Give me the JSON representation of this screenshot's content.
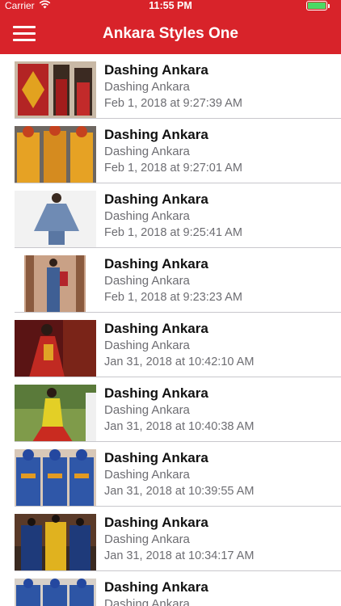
{
  "status": {
    "carrier": "Carrier",
    "time": "11:55 PM",
    "battery_color": "#4cd964"
  },
  "nav": {
    "title": "Ankara Styles One",
    "accent": "#d8232a"
  },
  "items": [
    {
      "title": "Dashing Ankara",
      "subtitle": "Dashing Ankara",
      "date": "Feb 1, 2018 at 9:27:39 AM"
    },
    {
      "title": "Dashing Ankara",
      "subtitle": "Dashing Ankara",
      "date": "Feb 1, 2018 at 9:27:01 AM"
    },
    {
      "title": "Dashing Ankara",
      "subtitle": "Dashing Ankara",
      "date": "Feb 1, 2018 at 9:25:41 AM"
    },
    {
      "title": "Dashing Ankara",
      "subtitle": "Dashing Ankara",
      "date": "Feb 1, 2018 at 9:23:23 AM"
    },
    {
      "title": "Dashing Ankara",
      "subtitle": "Dashing Ankara",
      "date": "Jan 31, 2018 at 10:42:10 AM"
    },
    {
      "title": "Dashing Ankara",
      "subtitle": "Dashing Ankara",
      "date": "Jan 31, 2018 at 10:40:38 AM"
    },
    {
      "title": "Dashing Ankara",
      "subtitle": "Dashing Ankara",
      "date": "Jan 31, 2018 at 10:39:55 AM"
    },
    {
      "title": "Dashing Ankara",
      "subtitle": "Dashing Ankara",
      "date": "Jan 31, 2018 at 10:34:17 AM"
    },
    {
      "title": "Dashing Ankara",
      "subtitle": "Dashing Ankara",
      "date": ""
    }
  ]
}
